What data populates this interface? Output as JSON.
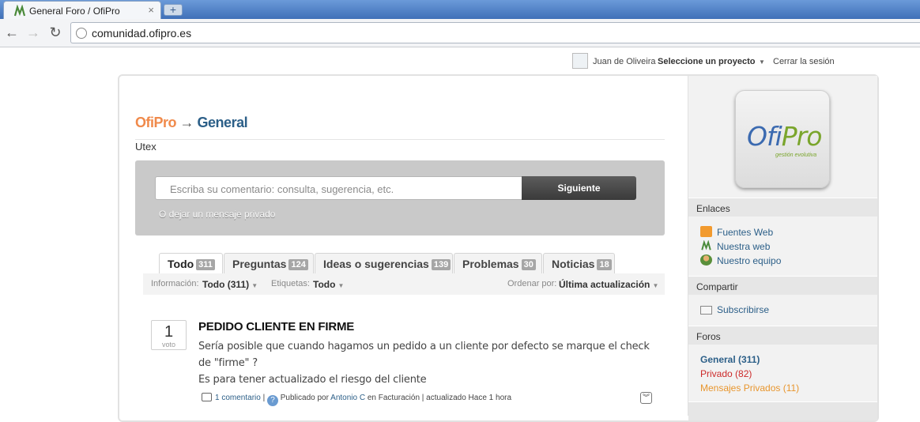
{
  "browser": {
    "tab_title": "General Foro / OfiPro",
    "url": "comunidad.ofipro.es",
    "new_tab": "+",
    "close": "×"
  },
  "user": {
    "name": "Juan de Oliveira",
    "project": "Seleccione un proyecto",
    "logout": "Cerrar la sesión"
  },
  "breadcrumb": {
    "root": "OfiPro",
    "arrow": "→",
    "current": "General"
  },
  "subtitle": "Utex",
  "composer": {
    "placeholder": "Escriba su comentario: consulta, sugerencia, etc.",
    "submit": "Siguiente",
    "private": "O dejar un mensaje privado"
  },
  "tabs": [
    {
      "label": "Todo",
      "count": "311"
    },
    {
      "label": "Preguntas",
      "count": "124"
    },
    {
      "label": "Ideas o sugerencias",
      "count": "139"
    },
    {
      "label": "Problemas",
      "count": "30"
    },
    {
      "label": "Noticias",
      "count": "18"
    }
  ],
  "filters": {
    "info_label": "Información:",
    "info_value": "Todo (311)",
    "tags_label": "Etiquetas:",
    "tags_value": "Todo",
    "order_label": "Ordenar por:",
    "order_value": "Última actualización"
  },
  "post": {
    "votes": "1",
    "votes_label": "voto",
    "title": "PEDIDO CLIENTE EN FIRME",
    "body1": "Sería posible que cuando hagamos un pedido a un cliente por defecto se marque el check de \"firme\" ?",
    "body2": "Es para tener actualizado el riesgo del cliente",
    "comments": "1 comentario",
    "sep": "|",
    "published_by": "Publicado por",
    "author": "Antonio C",
    "in": "en Facturación",
    "updated": "| actualizado Hace 1 hora"
  },
  "sidebar": {
    "logo_a": "Ofi",
    "logo_b": "Pro",
    "logo_sub": "gestión evolutiva",
    "links_header": "Enlaces",
    "links": [
      "Fuentes Web",
      "Nuestra web",
      "Nuestro equipo"
    ],
    "share_header": "Compartir",
    "share": "Subscribirse",
    "forums_header": "Foros",
    "forums": [
      "General (311)",
      "Privado (82)",
      "Mensajes Privados (11)"
    ],
    "colors": {
      "general": "#2c5f88",
      "privado": "#cc2a2a",
      "mensajes": "#e8962e"
    }
  }
}
